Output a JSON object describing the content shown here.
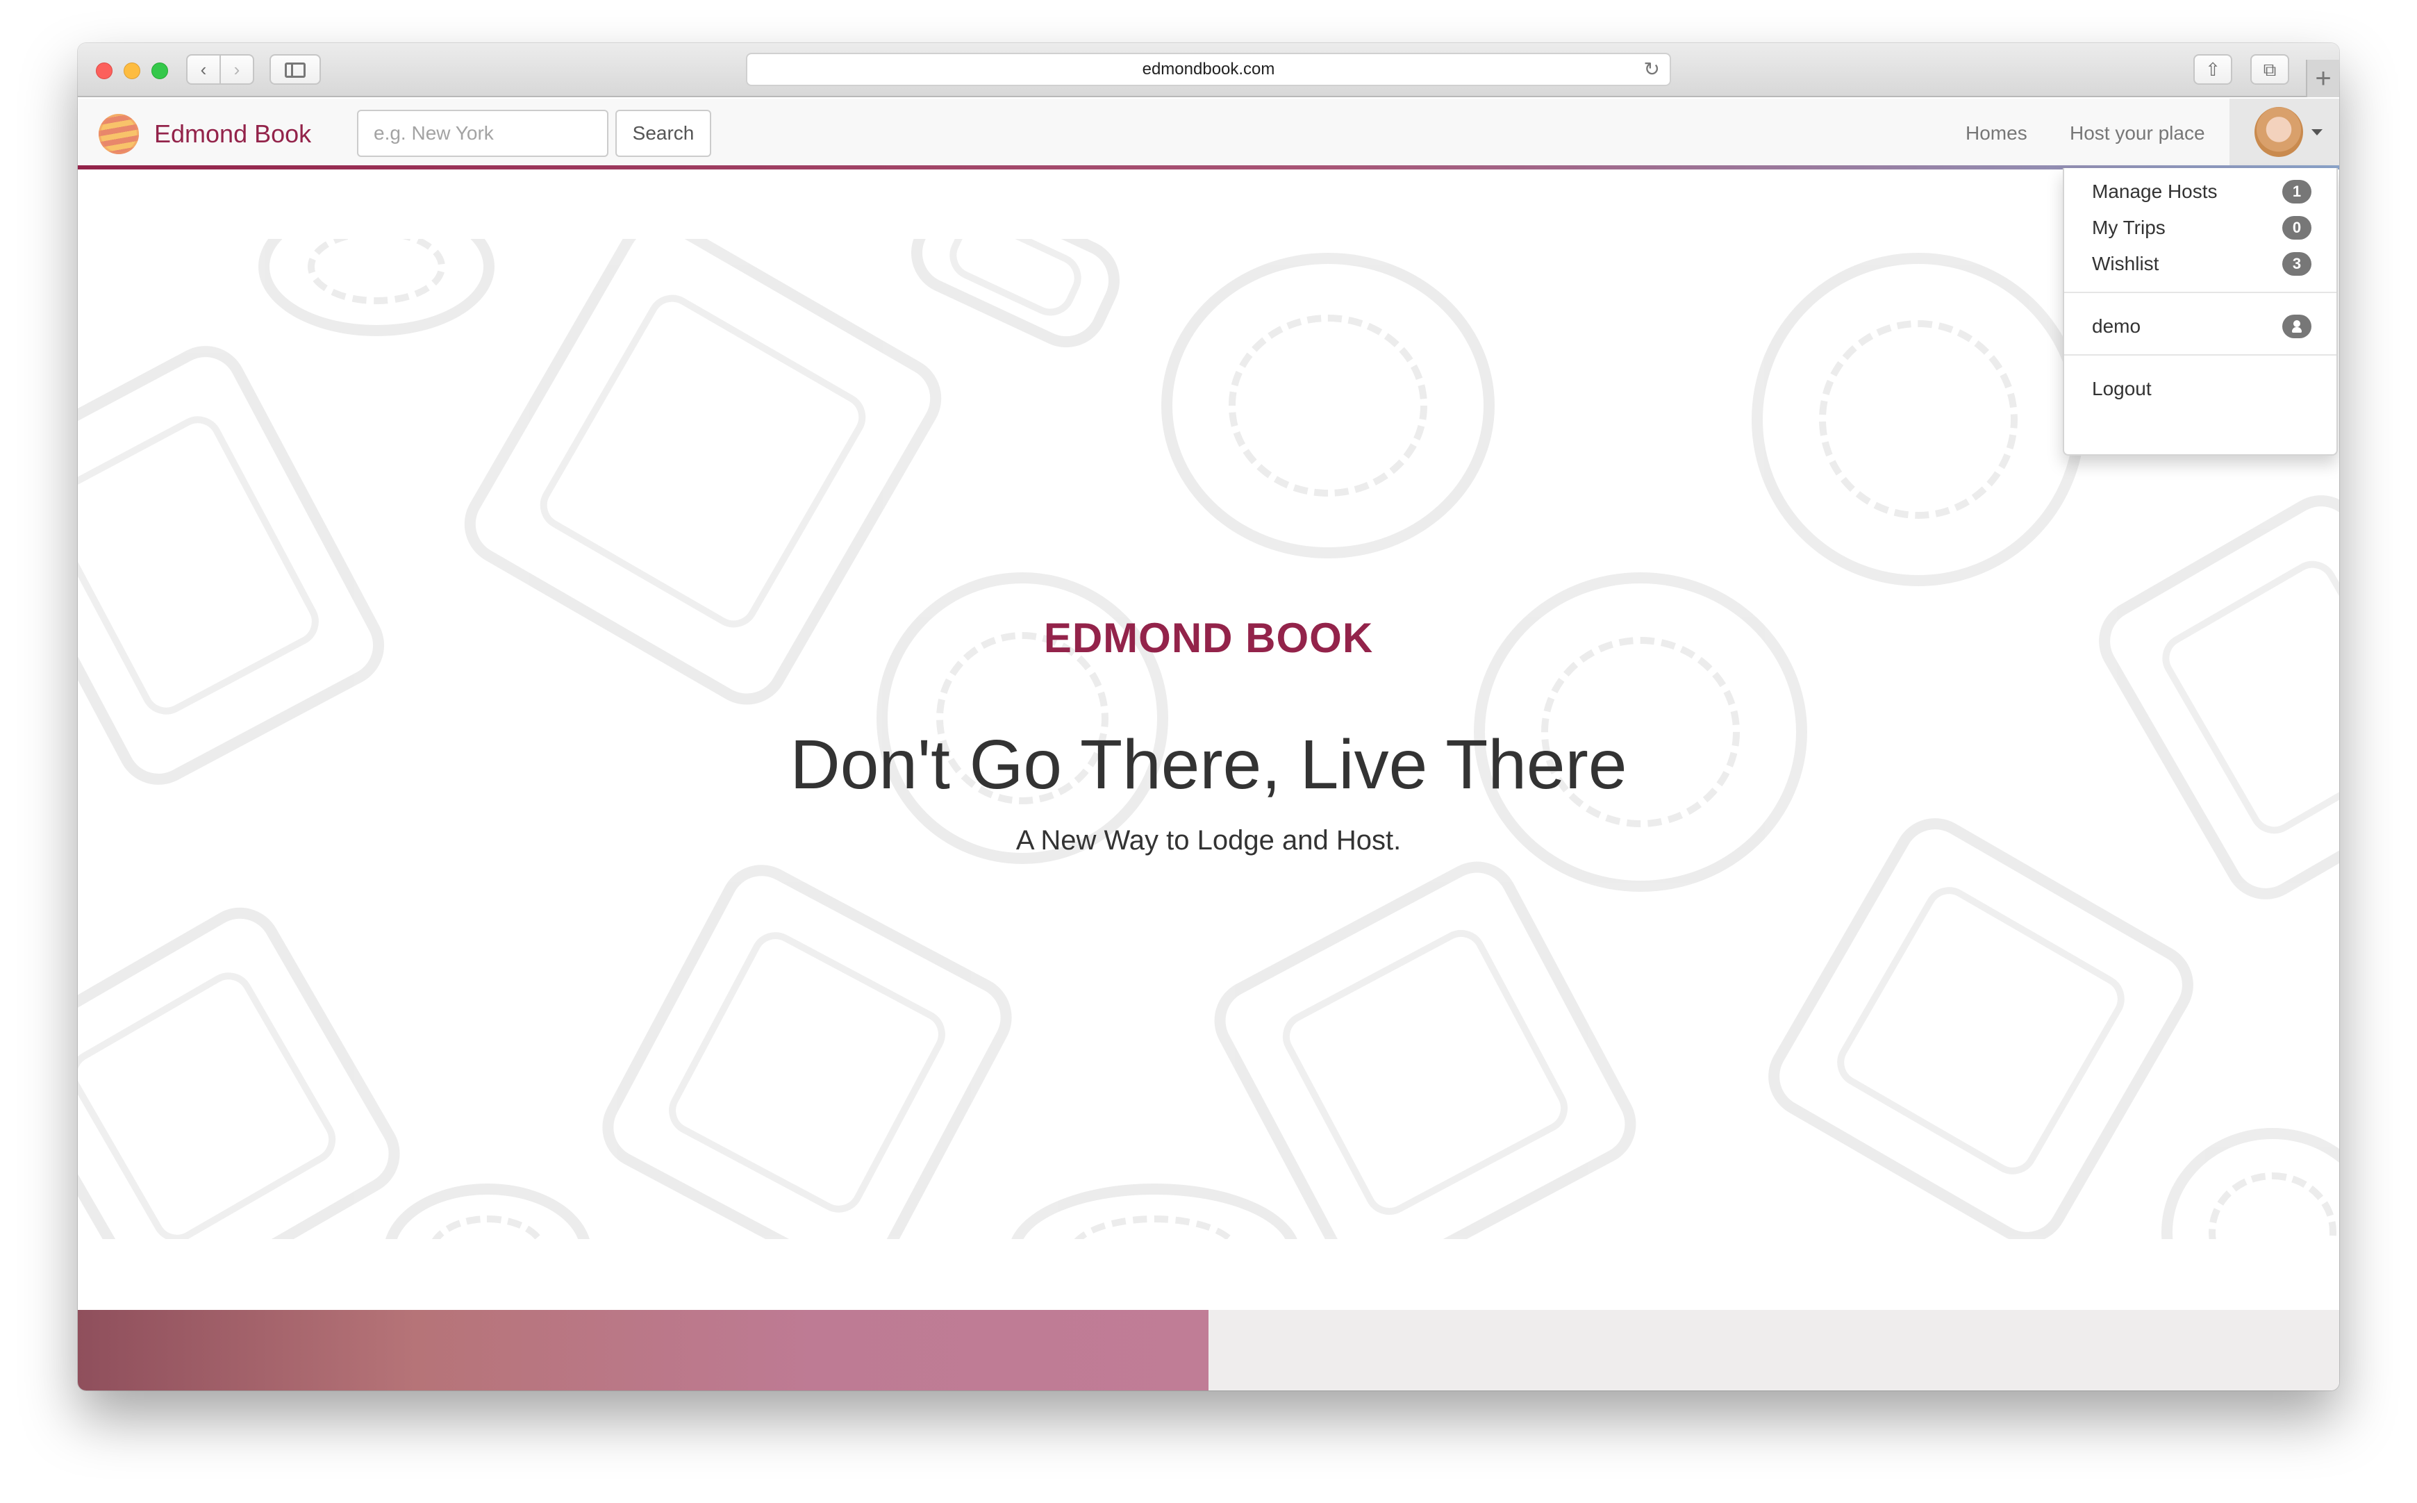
{
  "browser": {
    "url": "edmondbook.com",
    "icons": {
      "back": "chevron-left-icon",
      "forward": "chevron-right-icon",
      "sidebar": "sidebar-icon",
      "reload": "reload-icon",
      "share": "share-icon",
      "tabs": "tabs-icon",
      "new_tab": "plus-icon"
    }
  },
  "navbar": {
    "brand": "Edmond Book",
    "search_placeholder": "e.g. New York",
    "search_button": "Search",
    "links": {
      "homes": "Homes",
      "host": "Host your place"
    }
  },
  "dropdown": {
    "items": [
      {
        "label": "Manage Hosts",
        "badge": "1"
      },
      {
        "label": "My Trips",
        "badge": "0"
      },
      {
        "label": "Wishlist",
        "badge": "3"
      }
    ],
    "user": {
      "label": "demo",
      "icon": "user-icon"
    },
    "logout": "Logout"
  },
  "hero": {
    "brand": "EDMOND BOOK",
    "title": "Don't Go There, Live There",
    "subtitle": "A New Way to Lodge and Host."
  },
  "colors": {
    "brand": "#93234a",
    "badge": "#777777",
    "navbar_bg": "#f8f8f8"
  }
}
